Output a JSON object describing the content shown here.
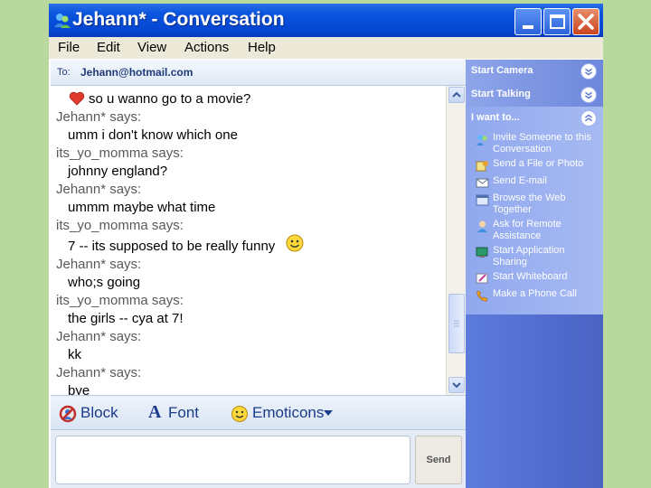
{
  "window": {
    "title": "Jehann* - Conversation"
  },
  "menu": [
    "File",
    "Edit",
    "View",
    "Actions",
    "Help"
  ],
  "to": {
    "label": "To:",
    "value": "Jehann@hotmail.com"
  },
  "conversation": [
    {
      "kind": "msg",
      "text": "so u wanno go to a movie?"
    },
    {
      "kind": "speaker",
      "text": "Jehann* says:"
    },
    {
      "kind": "msg",
      "text": "umm i don't  know which one"
    },
    {
      "kind": "speaker",
      "text": "its_yo_momma says:"
    },
    {
      "kind": "msg",
      "text": "johnny england?"
    },
    {
      "kind": "speaker",
      "text": "Jehann* says:"
    },
    {
      "kind": "msg",
      "text": "ummm maybe what time"
    },
    {
      "kind": "speaker",
      "text": "its_yo_momma says:"
    },
    {
      "kind": "msg",
      "text": "7 -- its supposed to be really funny"
    },
    {
      "kind": "speaker",
      "text": "Jehann* says:"
    },
    {
      "kind": "msg",
      "text": "who;s going"
    },
    {
      "kind": "speaker",
      "text": "its_yo_momma says:"
    },
    {
      "kind": "msg",
      "text": "the girls -- cya at 7!"
    },
    {
      "kind": "speaker",
      "text": "Jehann* says:"
    },
    {
      "kind": "msg",
      "text": "kk"
    },
    {
      "kind": "speaker",
      "text": "Jehann* says:"
    },
    {
      "kind": "msg",
      "text": "bye"
    }
  ],
  "toolbar": {
    "block": "Block",
    "font": "Font",
    "emoticons": "Emoticons",
    "font_glyph": "A"
  },
  "send": {
    "label": "Send"
  },
  "taskpane": {
    "start_camera": "Start Camera",
    "start_talking": "Start Talking",
    "i_want_to": "I want to...",
    "tasks": [
      {
        "label": "Invite Someone to this Conversation",
        "icon": "invite-icon"
      },
      {
        "label": "Send a File or Photo",
        "icon": "file-photo-icon"
      },
      {
        "label": "Send E-mail",
        "icon": "email-icon"
      },
      {
        "label": "Browse the Web Together",
        "icon": "browse-icon"
      },
      {
        "label": "Ask for Remote Assistance",
        "icon": "remote-assistance-icon"
      },
      {
        "label": "Start Application Sharing",
        "icon": "app-sharing-icon"
      },
      {
        "label": "Start Whiteboard",
        "icon": "whiteboard-icon"
      },
      {
        "label": "Make a Phone Call",
        "icon": "phone-icon"
      }
    ]
  },
  "colors": {
    "background": "#b8d89e",
    "titlebar": "#0546d1",
    "taskpane": "#4a62c2",
    "link": "#1a3b8a"
  }
}
